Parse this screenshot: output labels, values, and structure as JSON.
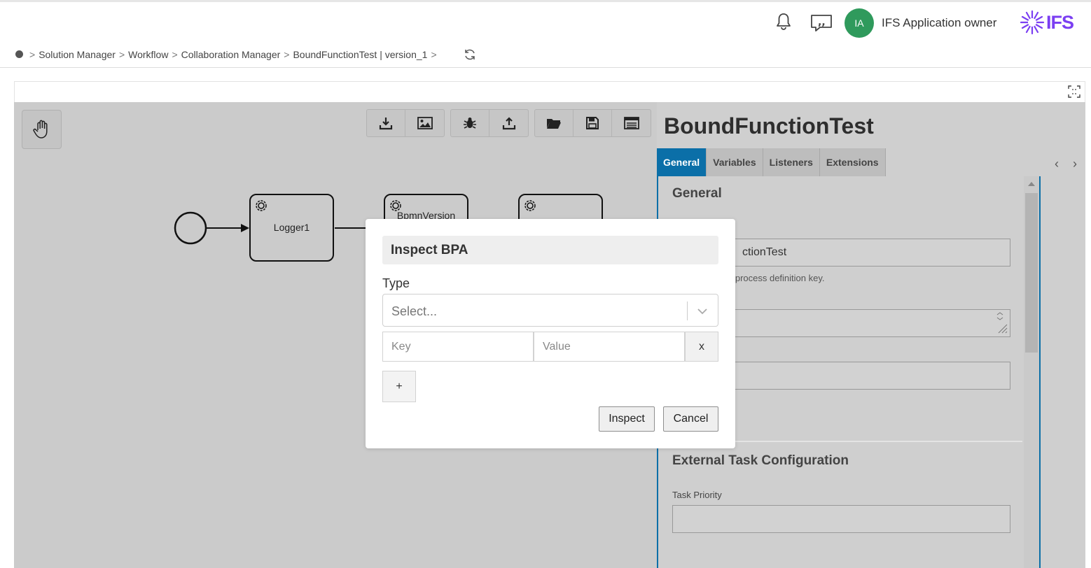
{
  "header": {
    "avatar_initials": "IA",
    "user_name": "IFS Application owner",
    "logo_text": "IFS",
    "logo_color": "#7b3ff2",
    "avatar_color": "#2f9a5c"
  },
  "breadcrumb": {
    "items": [
      "Solution Manager",
      "Workflow",
      "Collaboration Manager",
      "BoundFunctionTest | version_1"
    ]
  },
  "canvas": {
    "tasks": [
      "Logger1",
      "BpmnVersion",
      ""
    ]
  },
  "panel": {
    "title": "BoundFunctionTest",
    "tabs": [
      "General",
      "Variables",
      "Listeners",
      "Extensions"
    ],
    "active_tab": "General",
    "accent_color": "#0b6fa8",
    "general_title": "General",
    "id_value": "ctionTest",
    "id_hint": "e process definition key.",
    "external_title": "External Task Configuration",
    "task_priority_label": "Task Priority"
  },
  "modal": {
    "title": "Inspect BPA",
    "type_label": "Type",
    "select_placeholder": "Select...",
    "key_placeholder": "Key",
    "value_placeholder": "Value",
    "remove_label": "x",
    "add_label": "+",
    "inspect_label": "Inspect",
    "cancel_label": "Cancel"
  }
}
